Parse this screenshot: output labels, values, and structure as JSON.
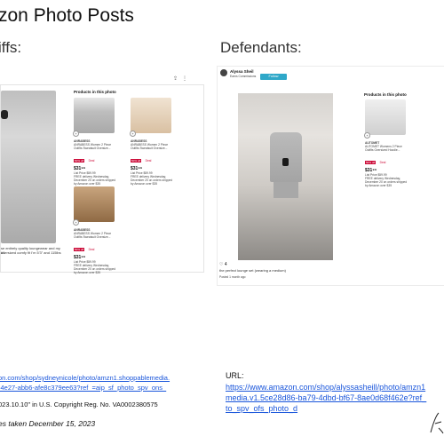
{
  "title": "zon Photo Posts",
  "left": {
    "heading": "iffs:",
    "products_heading": "Products in this photo",
    "products": [
      {
        "brand": "ANRABESS",
        "name": "ANRABESS Women 2 Piece Outfits Sweatsuit Oversize...",
        "badge": "50% off",
        "deal": "Deal",
        "price": "$31⁹⁹",
        "list_price": "List Price $59.99",
        "delivery": "FREE delivery Wednesday, December 20 on orders shipped by Amazon over $35"
      },
      {
        "brand": "ANRABESS",
        "name": "ANRABESS Women 2 Piece Outfits Sweatsuit Oversize...",
        "badge": "50% off",
        "deal": "Deal",
        "price": "$31⁹⁹",
        "list_price": "List Price $59.99",
        "delivery": "FREE delivery Wednesday, December 20 on orders shipped by Amazon over $35"
      },
      {
        "brand": "ANRABESS",
        "name": "ANRABESS Women 2 Piece Outfits Sweatsuit Oversize...",
        "badge": "50% off",
        "deal": "Deal",
        "price": "$31⁹⁹",
        "list_price": "List Price $59.99",
        "delivery": "FREE delivery Wednesday, December 20 on orders shipped by Amazon over $35"
      }
    ],
    "caption_1": "se entirely quality loungewear and my #1",
    "caption_2": "oversized comfy fit I'm 5'3\" and 115lbs",
    "url_line_1": "on.com/shop/sydneynicole/photo/amzn1.shoppablemedia.",
    "url_line_2": "-4e27-abb6-afe8c379ee63?ref_=aip_sf_photo_spv_ons_",
    "registration": "023.10.10\" in U.S. Copyright Reg. No. VA0002380575",
    "screenshot_note": "es taken December 15, 2023"
  },
  "right": {
    "heading": "Defendants:",
    "author_name": "Alyssa Sheil",
    "author_sub": "Earns Commissions",
    "follow_label": "Follow",
    "products_heading": "Products in this photo",
    "product": {
      "brand": "AUTOMET",
      "name": "AUTOMET Womens 2 Piece Outfits Oversized Hoodie...",
      "badge": "50% off",
      "deal": "Deal",
      "price": "$31⁹⁹",
      "list_price": "List Price $59.99",
      "delivery": "FREE delivery Wednesday, December 20 on orders shipped by Amazon over $35"
    },
    "likes": "4",
    "caption": "the perfect lounge set (wearing a medium)",
    "posted": "Posted 1 month ago",
    "url_label": "URL:",
    "url_line_1": "https://www.amazon.com/shop/alyssasheill/photo/amzn1",
    "url_line_2": "media.v1.5ce28d86-ba79-4dbd-bf67-8ae0d68f462e?ref_",
    "url_line_3": "to_spv_ofs_photo_d"
  },
  "colors": {
    "link": "#1a56db",
    "follow": "#2fa8c9",
    "badge": "#cc0c39"
  }
}
